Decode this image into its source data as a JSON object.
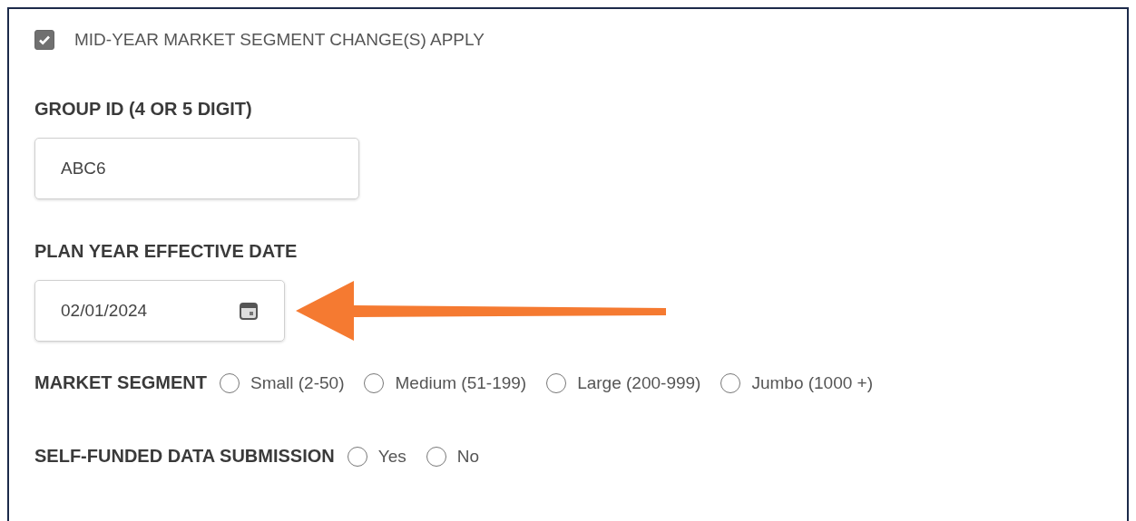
{
  "mid_year_change": {
    "label": "MID-YEAR MARKET SEGMENT CHANGE(S) APPLY",
    "checked": true
  },
  "fields": [
    {
      "kind": "text",
      "label": "GROUP ID (4 OR 5 DIGIT)",
      "value": "ABC6"
    },
    {
      "kind": "date",
      "label": "PLAN YEAR EFFECTIVE DATE",
      "value": "02/01/2024"
    }
  ],
  "radio_groups": [
    {
      "label": "MARKET SEGMENT",
      "options": [
        {
          "label": "Small (2-50)",
          "selected": false
        },
        {
          "label": "Medium (51-199)",
          "selected": false
        },
        {
          "label": "Large (200-999)",
          "selected": false
        },
        {
          "label": "Jumbo (1000 +)",
          "selected": false
        }
      ]
    },
    {
      "label": "SELF-FUNDED DATA SUBMISSION",
      "options": [
        {
          "label": "Yes",
          "selected": false
        },
        {
          "label": "No",
          "selected": false
        }
      ]
    }
  ]
}
